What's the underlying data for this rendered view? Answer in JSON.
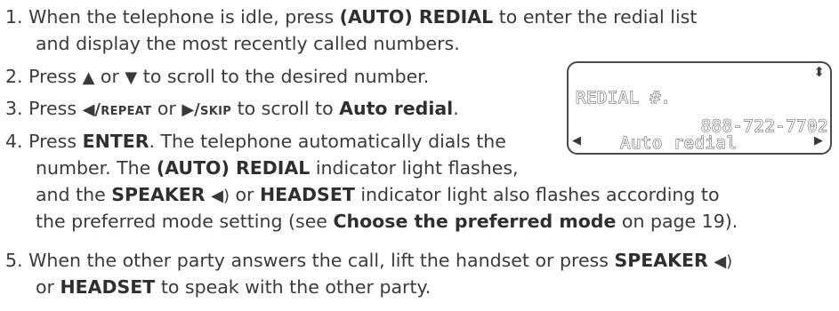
{
  "steps": [
    {
      "num": "1.",
      "line1_pre": " When the telephone is idle, press ",
      "line1_bold": "(AUTO) REDIAL",
      "line1_post": " to enter the redial list",
      "line2": "and display the most recently called numbers."
    },
    {
      "num": "2.",
      "pre": " Press ",
      "up_sym": "▲",
      "mid": " or ",
      "down_sym": "▼",
      "post": " to scroll to the desired number."
    },
    {
      "num": "3.",
      "pre": " Press ",
      "left_sym": "◀",
      "repeat_label": "/repeat",
      "mid": " or ",
      "right_sym": "▶",
      "skip_label": "/skip",
      "post": " to scroll to ",
      "bold": "Auto redial",
      "end": "."
    },
    {
      "num": "4.",
      "line1_pre": " Press ",
      "line1_bold": "ENTER",
      "line1_post": ". The telephone automatically dials the",
      "line2_pre": "number. The ",
      "line2_bold": "(AUTO) REDIAL",
      "line2_post": " indicator light flashes,",
      "line3_pre": "and the ",
      "line3_speaker": "SPEAKER",
      "line3_speaker_icon": "◀︎)",
      "line3_mid": " or ",
      "line3_headset": "HEADSET",
      "line3_post": " indicator light also flashes according to",
      "line4_pre": "the preferred mode setting (see ",
      "line4_bold": "Choose the preferred mode",
      "line4_post": " on page 19)."
    },
    {
      "num": "5.",
      "line1_pre": " When the other party answers the call, lift the handset or press ",
      "line1_bold": "SPEAKER",
      "line1_icon": "◀︎)",
      "line2_pre": "or ",
      "line2_bold": "HEADSET",
      "line2_post": " to speak with the other party."
    }
  ],
  "lcd": {
    "title": "REDIAL #.",
    "number": "888-722-7702",
    "sub": "Auto redial",
    "updown_icon": "⬍",
    "left_arrow": "◀",
    "right_arrow": "▶"
  },
  "colors": {
    "text": "#3a3a3a",
    "lcd_border": "#4a4a4a"
  }
}
